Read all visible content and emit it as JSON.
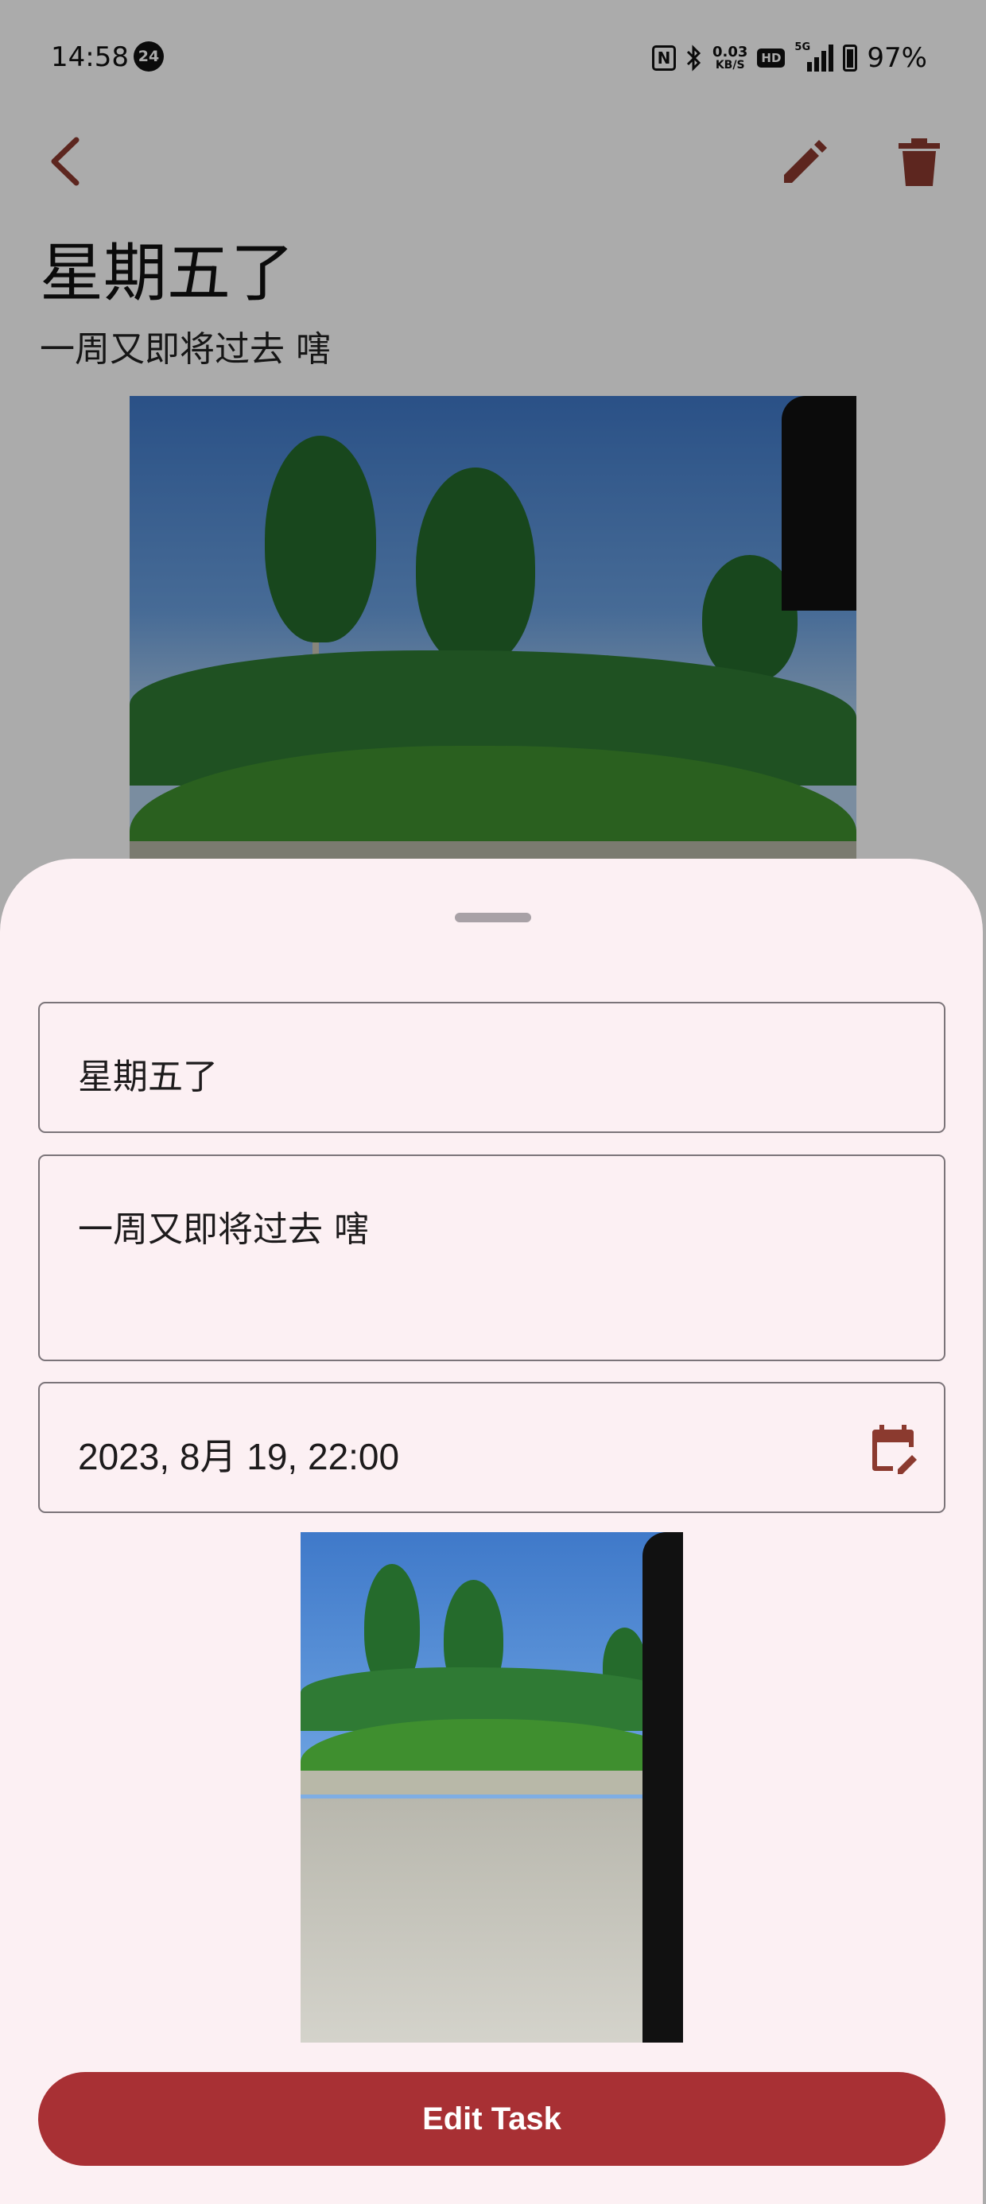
{
  "status_bar": {
    "time": "14:58",
    "notification_badge": "24",
    "net_speed_value": "0.03",
    "net_speed_unit": "KB/S",
    "hd_label": "HD",
    "network_type": "5G",
    "battery_percent": "97%"
  },
  "task": {
    "title": "星期五了",
    "description": "一周又即将过去 嗐"
  },
  "edit_sheet": {
    "title_value": "星期五了",
    "description_value": "一周又即将过去 嗐",
    "date_value": "2023, 8月 19, 22:00",
    "submit_label": "Edit Task"
  },
  "icons": {
    "back": "chevron-left-icon",
    "edit": "pencil-icon",
    "delete": "trash-icon",
    "calendar": "calendar-edit-icon"
  },
  "colors": {
    "accent": "#a83034",
    "icon": "#8b3a2f",
    "sheet_background": "#fcf0f3",
    "field_border": "#7b7479"
  }
}
